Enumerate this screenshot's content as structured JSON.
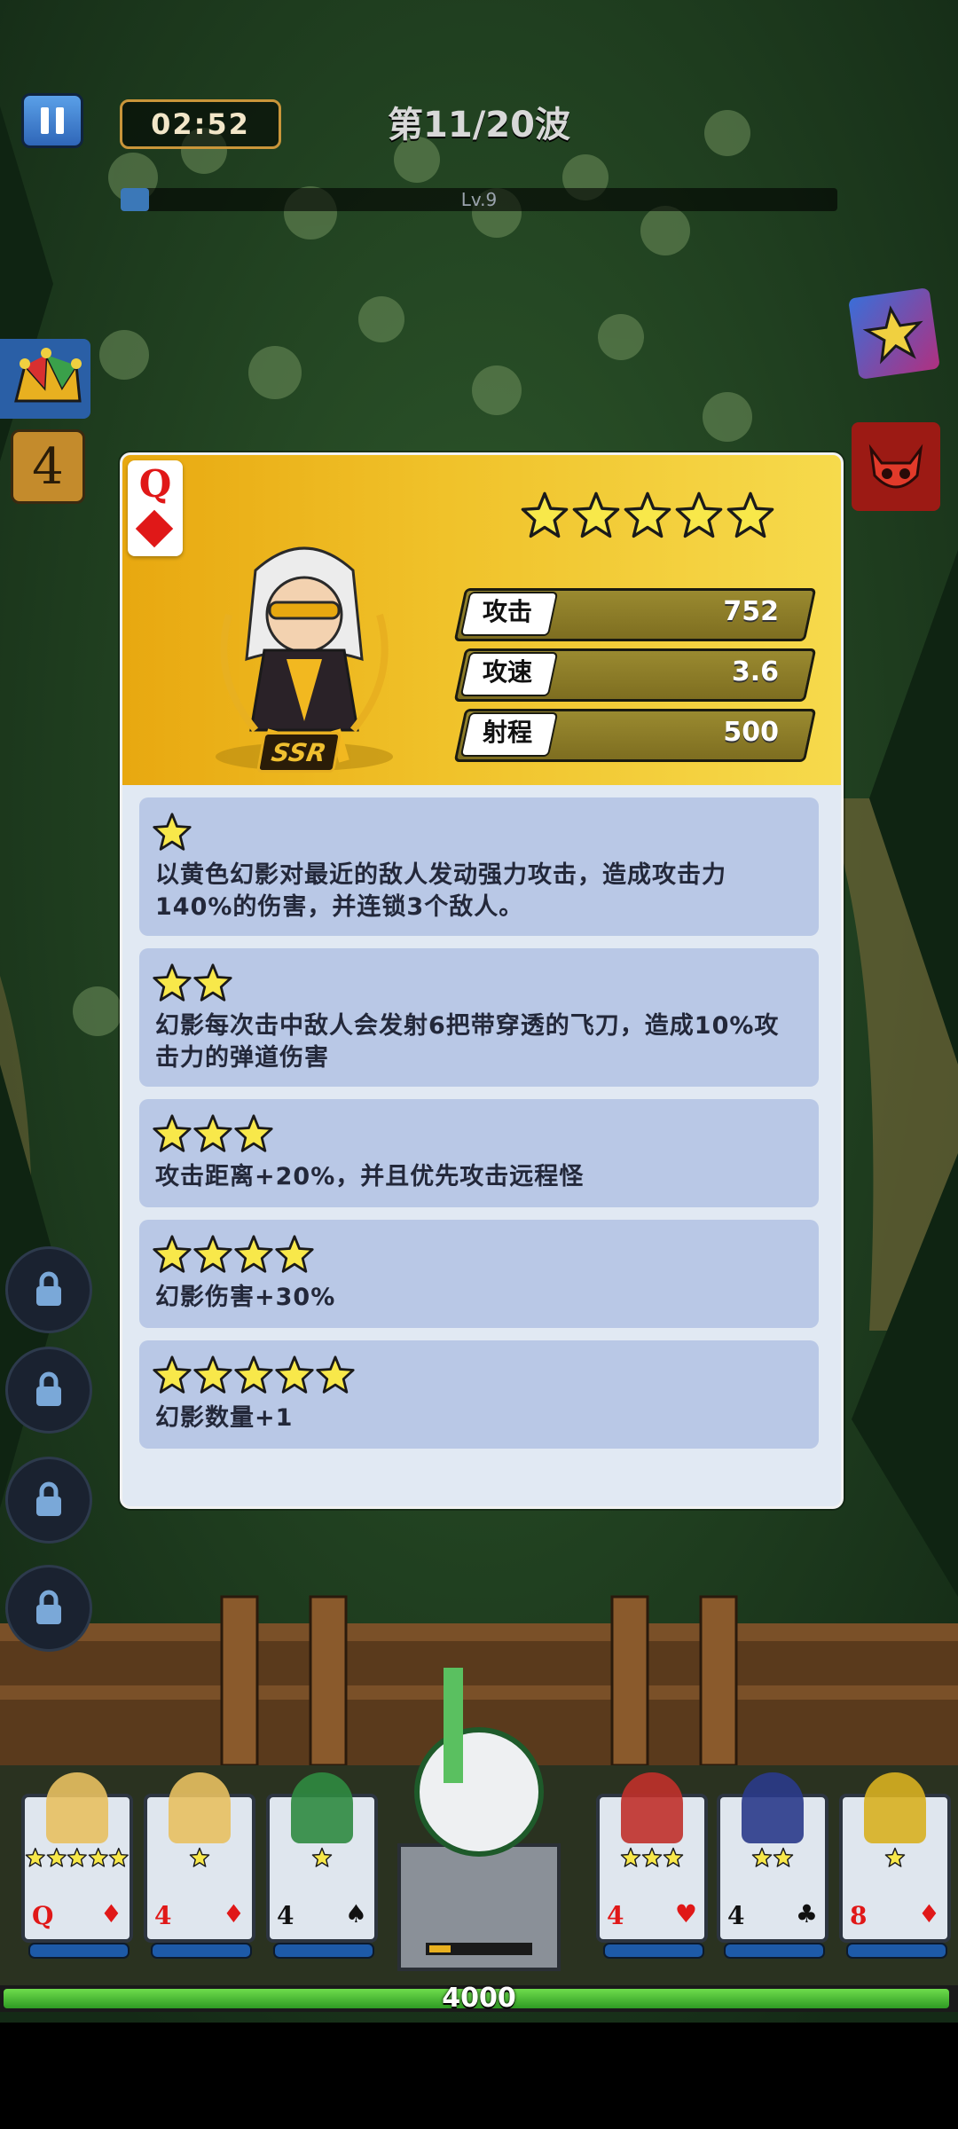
{
  "hud": {
    "timer": "02:52",
    "wave": "第11/20波",
    "level_label": "Lv.9",
    "level_progress": 0.04,
    "side_level": "4"
  },
  "hero_detail": {
    "card_rank": "Q",
    "card_suit": "diamond",
    "rarity": "SSR",
    "star_count": 5,
    "stats": [
      {
        "label": "攻击",
        "value": "752"
      },
      {
        "label": "攻速",
        "value": "3.6"
      },
      {
        "label": "射程",
        "value": "500"
      }
    ],
    "skills": [
      {
        "stars": 1,
        "text": [
          "以黄色幻影对最近的敌人发动强力攻击，造成攻击力",
          "140%的伤害，并连锁3个敌人。"
        ]
      },
      {
        "stars": 2,
        "text": [
          "幻影每次击中敌人会发射6把带穿透的飞刀，造成10%攻",
          "击力的弹道伤害"
        ]
      },
      {
        "stars": 3,
        "text": [
          "攻击距离+20%，并且优先攻击远程怪"
        ]
      },
      {
        "stars": 4,
        "text": [
          "幻影伤害+30%"
        ]
      },
      {
        "stars": 5,
        "text": [
          "幻影数量+1"
        ]
      }
    ]
  },
  "bottom": {
    "cards": [
      {
        "rank": "Q",
        "suit": "♦",
        "stars": 5,
        "color": "#e01818"
      },
      {
        "rank": "4",
        "suit": "♦",
        "stars": 1,
        "color": "#e01818"
      },
      {
        "rank": "4",
        "suit": "♠",
        "stars": 1,
        "color": "#111111"
      },
      {
        "rank": "4",
        "suit": "♥",
        "stars": 3,
        "color": "#e01818"
      },
      {
        "rank": "4",
        "suit": "♣",
        "stars": 2,
        "color": "#111111"
      },
      {
        "rank": "8",
        "suit": "♦",
        "stars": 1,
        "color": "#e01818"
      }
    ],
    "base_hp": "4000"
  },
  "colors": {
    "star_fill": "#f8e84a",
    "panel_gold": "#f0c22a",
    "skill_bg": "#b9c8e6"
  }
}
